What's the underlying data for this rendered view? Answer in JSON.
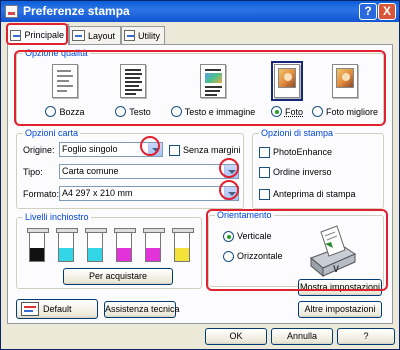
{
  "window": {
    "title": "Preferenze stampa",
    "help_label": "?",
    "close_label": "X"
  },
  "tabs": [
    {
      "label": "Principale",
      "active": true
    },
    {
      "label": "Layout",
      "active": false
    },
    {
      "label": "Utility",
      "active": false
    }
  ],
  "quality": {
    "title": "Opzione qualità",
    "options": [
      {
        "label": "Bozza",
        "selected": false,
        "icon": "draft-document-icon"
      },
      {
        "label": "Testo",
        "selected": false,
        "icon": "text-document-icon"
      },
      {
        "label": "Testo e immagine",
        "selected": false,
        "icon": "text-image-document-icon"
      },
      {
        "label": "Foto",
        "selected": true,
        "icon": "photo-icon"
      },
      {
        "label": "Foto migliore",
        "selected": false,
        "icon": "best-photo-icon"
      }
    ]
  },
  "paper": {
    "title": "Opzioni carta",
    "source_label": "Origine:",
    "source_value": "Foglio singolo",
    "borderless_label": "Senza margini",
    "type_label": "Tipo:",
    "type_value": "Carta comune",
    "size_label": "Formato:",
    "size_value": "A4 297 x 210 mm"
  },
  "print_options": {
    "title": "Opzioni di stampa",
    "items": [
      {
        "label": "PhotoEnhance",
        "checked": false
      },
      {
        "label": "Ordine inverso",
        "checked": false
      },
      {
        "label": "Anteprima di stampa",
        "checked": false
      }
    ]
  },
  "ink": {
    "title": "Livelli inchiostro",
    "cartridges": [
      {
        "color": "#111111",
        "level": 0.45
      },
      {
        "color": "#33d6e6",
        "level": 0.45
      },
      {
        "color": "#33d6e6",
        "level": 0.45
      },
      {
        "color": "#e233d8",
        "level": 0.45
      },
      {
        "color": "#e233d8",
        "level": 0.45
      },
      {
        "color": "#f2e23a",
        "level": 0.45
      }
    ],
    "buy_button": "Per acquistare"
  },
  "orientation": {
    "title": "Orientamento",
    "portrait_label": "Verticale",
    "landscape_label": "Orizzontale",
    "portrait_selected": true
  },
  "buttons": {
    "default": "Default",
    "tech_support": "Assistenza tecnica",
    "show_settings": "Mostra impostazioni",
    "other_settings": "Altre impostazioni",
    "ok": "OK",
    "cancel": "Annulla",
    "help": "?"
  },
  "colors": {
    "highlight": "#e0212f",
    "group_label": "#0046d5"
  }
}
